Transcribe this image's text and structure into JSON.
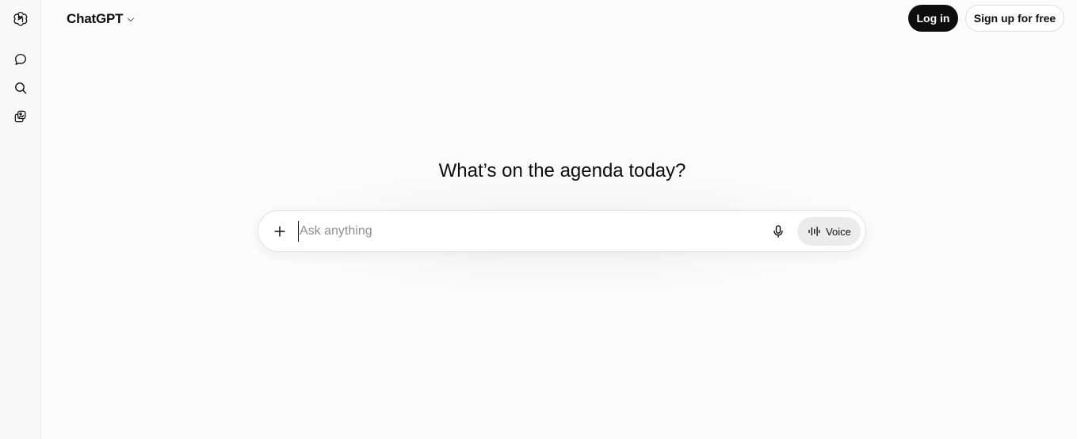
{
  "app": {
    "model_name": "ChatGPT"
  },
  "header": {
    "login_label": "Log in",
    "signup_label": "Sign up for free"
  },
  "rail": {
    "icons": [
      "openai-logo-icon",
      "new-chat-icon",
      "search-icon",
      "library-icon"
    ]
  },
  "main": {
    "headline": "What’s on the agenda today?",
    "composer": {
      "placeholder": "Ask anything",
      "value": "",
      "voice_label": "Voice"
    }
  },
  "colors": {
    "background": "#fcfcfc",
    "rail_background": "#f9f9f9",
    "primary_button": "#0d0d0d",
    "voice_button": "#ececec",
    "placeholder": "#8f8f8f"
  }
}
